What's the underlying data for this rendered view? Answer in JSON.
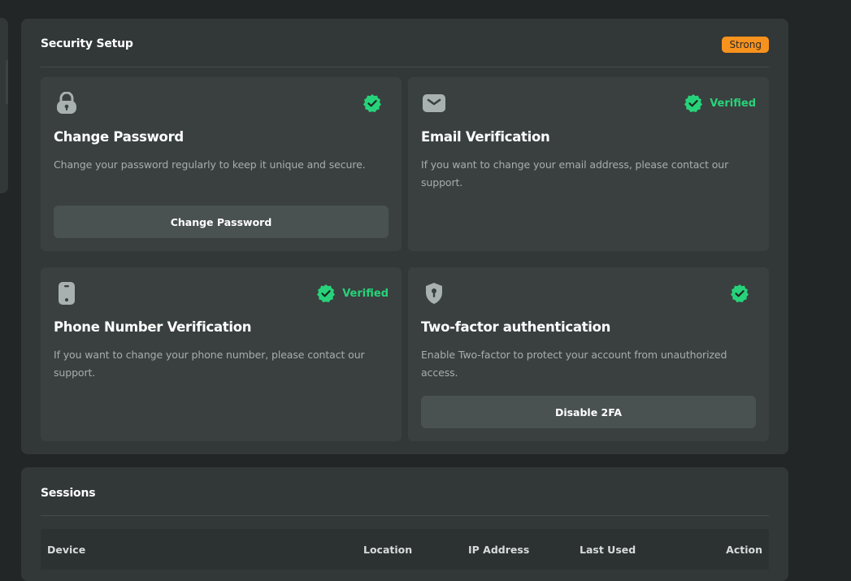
{
  "security": {
    "title": "Security Setup",
    "strength_badge": "Strong",
    "colors": {
      "verified": "#27d37a",
      "badge": "#f7921e",
      "panel": "#323737",
      "card": "#3a4040"
    },
    "cards": [
      {
        "icon": "lock-icon",
        "title": "Change Password",
        "description": "Change your password regularly to keep it unique and secure.",
        "status_label": "",
        "button_label": "Change Password"
      },
      {
        "icon": "email-icon",
        "title": "Email Verification",
        "description": "If you want to change your email address, please contact our support.",
        "status_label": "Verified",
        "button_label": ""
      },
      {
        "icon": "phone-icon",
        "title": "Phone Number Verification",
        "description": "If you want to change your phone number, please contact our support.",
        "status_label": "Verified",
        "button_label": ""
      },
      {
        "icon": "shield-icon",
        "title": "Two-factor authentication",
        "description": "Enable Two-factor to protect your account from unauthorized access.",
        "status_label": "",
        "button_label": "Disable 2FA"
      }
    ]
  },
  "sessions": {
    "title": "Sessions",
    "columns": [
      "Device",
      "Location",
      "IP Address",
      "Last Used",
      "Action"
    ]
  }
}
